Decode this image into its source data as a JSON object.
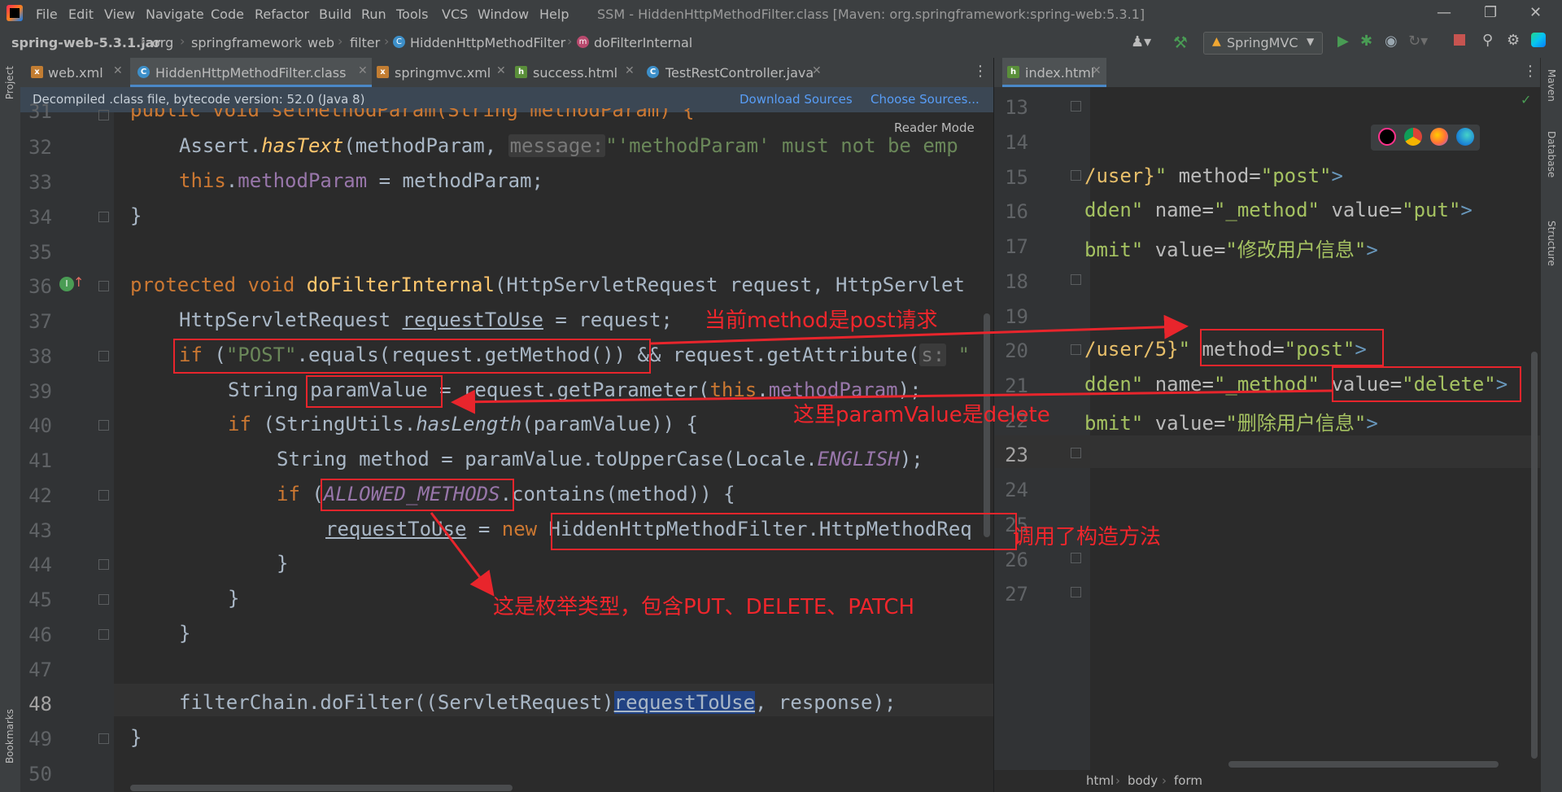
{
  "titlebar": {
    "menu": [
      "File",
      "Edit",
      "View",
      "Navigate",
      "Code",
      "Refactor",
      "Build",
      "Run",
      "Tools",
      "VCS",
      "Window",
      "Help"
    ],
    "window_title": "SSM - HiddenHttpMethodFilter.class [Maven: org.springframework:spring-web:5.3.1]"
  },
  "navbar": {
    "crumbs": [
      "spring-web-5.3.1.jar",
      "org",
      "springframework",
      "web",
      "filter",
      "HiddenHttpMethodFilter",
      "doFilterInternal"
    ],
    "run_config": "SpringMVC"
  },
  "tabs_left": [
    "web.xml",
    "HiddenHttpMethodFilter.class",
    "springmvc.xml",
    "success.html",
    "TestRestController.java"
  ],
  "tabs_right": [
    "index.html"
  ],
  "notice": {
    "text": "Decompiled .class file, bytecode version: 52.0 (Java 8)",
    "download": "Download Sources",
    "choose": "Choose Sources..."
  },
  "reader_mode": "Reader Mode",
  "side_left": [
    "Project",
    "Bookmarks"
  ],
  "side_right": [
    "Maven",
    "Database",
    "Structure"
  ],
  "left_lines": [
    "31",
    "32",
    "33",
    "34",
    "35",
    "36",
    "37",
    "38",
    "39",
    "40",
    "41",
    "42",
    "43",
    "44",
    "45",
    "46",
    "47",
    "48",
    "49",
    "50"
  ],
  "code": {
    "l32_a": "Assert.",
    "l32_fn": "hasText",
    "l32_b": "(methodParam, ",
    "l32_hint": "message:",
    "l32_str": "\"'methodParam' must not be emp",
    "l33_kw": "this",
    "l33_a": ".",
    "l33_fld": "methodParam",
    "l33_b": " = methodParam;",
    "l34": "}",
    "l36_kw": "protected void ",
    "l36_fn": "doFilterInternal",
    "l36_b": "(HttpServletRequest request, HttpServlet",
    "l37_a": "HttpServletRequest ",
    "l37_var": "requestToUse",
    "l37_b": " = request;",
    "l38_kw": "if",
    "l38_a": " (",
    "l38_str": "\"POST\"",
    "l38_b": ".equals(request.getMethod()) && request.getAttribute(",
    "l38_hint": "s:",
    "l38_c": " \"",
    "l39_a": "String ",
    "l39_var": "paramValue",
    "l39_b": " = request.getParameter(",
    "l39_kw": "this",
    "l39_c": ".",
    "l39_fld": "methodParam",
    "l39_d": ");",
    "l40_kw": "if",
    "l40_a": " (StringUtils.",
    "l40_fn": "hasLength",
    "l40_b": "(paramValue)) {",
    "l41_a": "String method = paramValue.toUpperCase(Locale.",
    "l41_it": "ENGLISH",
    "l41_b": ");",
    "l42_kw": "if",
    "l42_a": " (",
    "l42_it": "ALLOWED_METHODS",
    "l42_b": ".contains(method)) {",
    "l43_var": "requestToUse",
    "l43_a": " = ",
    "l43_kw": "new",
    "l43_b": " HiddenHttpMethodFilter.HttpMethodReq",
    "l44": "}",
    "l45": "}",
    "l46": "}",
    "l48_a": "filterChain.doFilter((ServletRequest)",
    "l48_var": "requestToUse",
    "l48_b": ", response);",
    "l49": "}",
    "l31": "public void setMethodParam(String methodParam) {"
  },
  "right_lines": [
    "13",
    "14",
    "15",
    "16",
    "17",
    "18",
    "19",
    "20",
    "21",
    "22",
    "23",
    "24",
    "25",
    "26",
    "27"
  ],
  "html_code": {
    "r15_a": "/user}",
    "r15_b": "\" ",
    "r15_attr": "method=",
    "r15_val": "\"post\"",
    "r15_c": ">",
    "r16_a": "dden\" ",
    "r16_attr1": "name=",
    "r16_val1": "\"_method\"",
    "r16_attr2": " value=",
    "r16_val2": "\"put\"",
    "r16_c": ">",
    "r17_a": "bmit\" ",
    "r17_attr": "value=",
    "r17_val": "\"修改用户信息\"",
    "r17_c": ">",
    "r20_a": "/user/5}",
    "r20_b": "\" ",
    "r20_attr": "method=",
    "r20_val": "\"post\"",
    "r20_c": ">",
    "r21_a": "dden\" ",
    "r21_attr1": "name=",
    "r21_val1": "\"_method\"",
    "r21_attr2": " value=",
    "r21_val2": "\"delete\"",
    "r21_c": ">",
    "r22_a": "bmit\" ",
    "r22_attr": "value=",
    "r22_val": "\"删除用户信息\"",
    "r22_c": ">"
  },
  "html_breadcrumb": [
    "html",
    "body",
    "form"
  ],
  "annotations": {
    "post_request": "当前method是post请求",
    "param_delete": "这里paramValue是delete",
    "constructor": "调用了构造方法",
    "enum_type": "这是枚举类型，包含PUT、DELETE、PATCH"
  },
  "colors": {
    "annotation_red": "#e8252c",
    "keyword": "#cc7832",
    "string": "#6a8759",
    "field": "#9876aa",
    "function": "#ffc66d",
    "background": "#2b2b2b"
  }
}
